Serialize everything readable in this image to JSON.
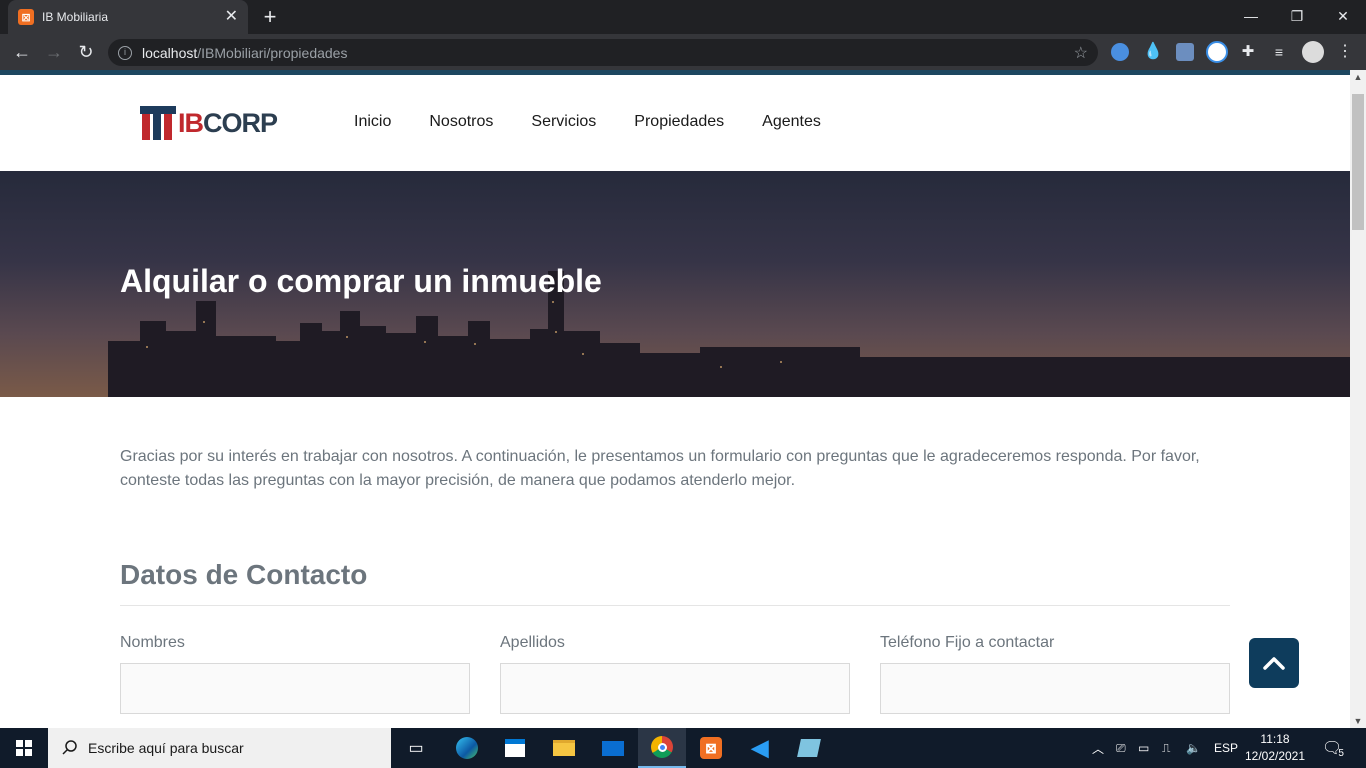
{
  "browser": {
    "tab_title": "IB Mobiliaria",
    "tab_favicon": "XAMPP",
    "url_host": "localhost",
    "url_path": "/IBMobiliari/propiedades",
    "colors": {
      "frame": "#202124",
      "toolbar": "#35363a"
    }
  },
  "site": {
    "logo": {
      "text_ib": "IB",
      "text_corp": "CORP"
    },
    "nav": [
      {
        "label": "Inicio"
      },
      {
        "label": "Nosotros"
      },
      {
        "label": "Servicios"
      },
      {
        "label": "Propiedades"
      },
      {
        "label": "Agentes"
      }
    ],
    "hero": {
      "title": "Alquilar o comprar un inmueble"
    },
    "intro": "Gracias por su interés en trabajar con nosotros. A continuación, le presentamos un formulario con preguntas que le agradeceremos responda. Por favor, conteste todas las preguntas con la mayor precisión, de manera que podamos atenderlo mejor.",
    "section_title": "Datos de Contacto",
    "fields": [
      {
        "label": "Nombres",
        "value": ""
      },
      {
        "label": "Apellidos",
        "value": ""
      },
      {
        "label": "Teléfono Fijo a contactar",
        "value": ""
      }
    ],
    "colors": {
      "accent": "#0e3c5c",
      "brand_red": "#c0282d",
      "text_muted": "#6c757d"
    }
  },
  "taskbar": {
    "search_placeholder": "Escribe aquí para buscar",
    "language": "ESP",
    "time": "11:18",
    "date": "12/02/2021",
    "notification_count": "5"
  }
}
